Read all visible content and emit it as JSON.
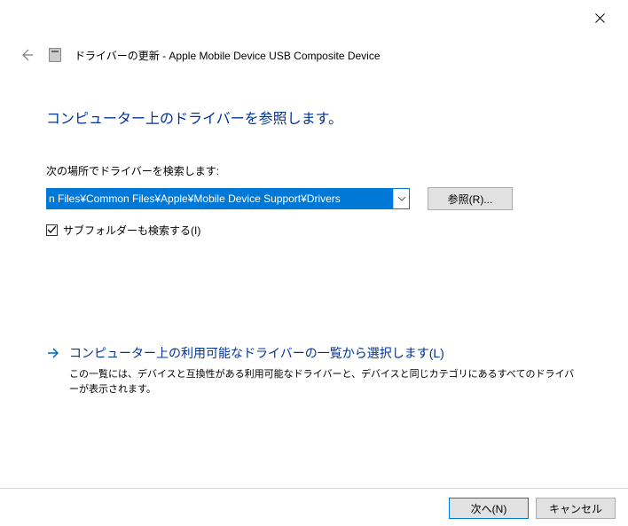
{
  "window": {
    "title": "ドライバーの更新 - Apple Mobile Device USB Composite Device"
  },
  "main": {
    "heading": "コンピューター上のドライバーを参照します。",
    "search_label": "次の場所でドライバーを検索します:",
    "path_value": "n Files¥Common Files¥Apple¥Mobile Device Support¥Drivers",
    "browse_label": "参照(R)...",
    "subfolder_label": "サブフォルダーも検索する(I)",
    "subfolder_checked": true
  },
  "link": {
    "title": "コンピューター上の利用可能なドライバーの一覧から選択します(L)",
    "description": "この一覧には、デバイスと互換性がある利用可能なドライバーと、デバイスと同じカテゴリにあるすべてのドライバーが表示されます。"
  },
  "footer": {
    "next_label": "次へ(N)",
    "cancel_label": "キャンセル"
  }
}
